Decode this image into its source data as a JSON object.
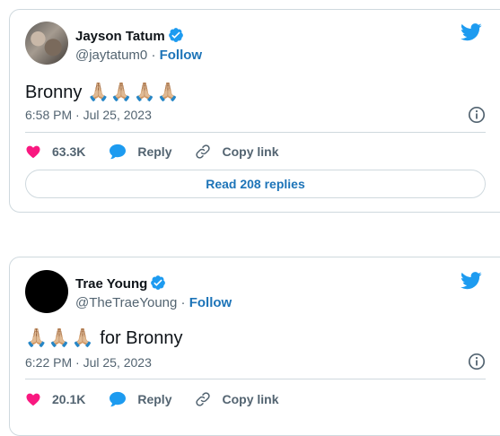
{
  "tweets": [
    {
      "name": "Jayson Tatum",
      "handle": "@jaytatum0",
      "separator": "·",
      "follow": "Follow",
      "text": "Bronny",
      "emoji": "🙏🏼🙏🏼🙏🏼🙏🏼",
      "timestamp": "6:58 PM · Jul 25, 2023",
      "likes": "63.3K",
      "reply": "Reply",
      "copy_link": "Copy link",
      "read_replies": "Read 208 replies"
    },
    {
      "name": "Trae Young",
      "handle": "@TheTraeYoung",
      "separator": "·",
      "follow": "Follow",
      "text": "for Bronny",
      "emoji": "🙏🏼🙏🏼🙏🏼",
      "timestamp": "6:22 PM · Jul 25, 2023",
      "likes": "20.1K",
      "reply": "Reply",
      "copy_link": "Copy link"
    }
  ],
  "icons": {
    "verified": "verified-badge-icon",
    "logo": "twitter-bird-icon",
    "info": "info-icon",
    "like": "heart-icon",
    "reply": "speech-bubble-icon",
    "copy": "link-icon"
  },
  "colors": {
    "accent": "#1d9bf0",
    "link": "#1d74b8",
    "like": "#f91880",
    "muted": "#536471",
    "border": "#cfd9de"
  }
}
